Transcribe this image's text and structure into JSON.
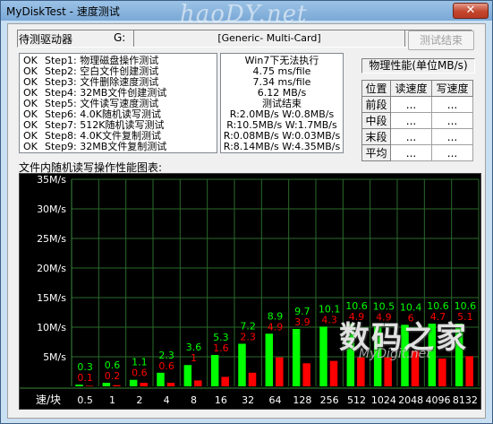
{
  "window": {
    "title": "MyDiskTest - 速度测试",
    "watermark_top": "haoDY.net",
    "close_label": "✕"
  },
  "toolbar": {
    "drive_label": "待测驱动器",
    "drive_letter": "G:",
    "drive_name": "[Generic- Multi-Card]",
    "end_button": "测试结束"
  },
  "steps": [
    {
      "status": "OK",
      "name": "Step1: 物理磁盘操作测试"
    },
    {
      "status": "OK",
      "name": "Step2: 空白文件创建测试"
    },
    {
      "status": "OK",
      "name": "Step3: 文件删除速度测试"
    },
    {
      "status": "OK",
      "name": "Step4: 32MB文件创建测试"
    },
    {
      "status": "OK",
      "name": "Step5: 文件读写速度测试"
    },
    {
      "status": "OK",
      "name": "Step6: 4.0K随机读写测试"
    },
    {
      "status": "OK",
      "name": "Step7: 512K随机读写测试"
    },
    {
      "status": "OK",
      "name": "Step8: 4.0K文件复制测试"
    },
    {
      "status": "OK",
      "name": "Step9: 32MB文件复制测试"
    }
  ],
  "results": [
    "Win7下无法执行",
    "4.75 ms/file",
    "7.34 ms/file",
    "6.12 MB/s",
    "测试结束",
    "R:2.0MB/s W:0.8MB/s",
    "R:10.5MB/s W:1.7MB/s",
    "R:0.08MB/s W:0.03MB/s",
    "R:8.14MB/s W:4.35MB/s"
  ],
  "performance": {
    "title": "物理性能(单位MB/s)",
    "headers": [
      "位置",
      "读速度",
      "写速度"
    ],
    "rows": [
      {
        "pos": "前段",
        "read": "...",
        "write": "..."
      },
      {
        "pos": "中段",
        "read": "...",
        "write": "..."
      },
      {
        "pos": "末段",
        "read": "...",
        "write": "..."
      },
      {
        "pos": "平均",
        "read": "...",
        "write": "..."
      }
    ]
  },
  "chart_label": "文件内随机读写操作性能图表:",
  "chart_data": {
    "type": "bar",
    "ylim": [
      0,
      35
    ],
    "yticks": [
      5,
      10,
      15,
      20,
      25,
      30,
      35
    ],
    "ytick_labels": [
      "5M/s",
      "10M/s",
      "15M/s",
      "20M/s",
      "25M/s",
      "30M/s",
      "35M/s"
    ],
    "x_header": "速/块",
    "categories": [
      "0.5",
      "1",
      "2",
      "4",
      "8",
      "16",
      "32",
      "64",
      "128",
      "256",
      "512",
      "1024",
      "2048",
      "4096",
      "8192"
    ],
    "category_labels": [
      "0.5",
      "1",
      "2",
      "4",
      "8",
      "16",
      "32",
      "64",
      "128",
      "256",
      "512",
      "1024",
      "2048",
      "4096",
      "8132"
    ],
    "grid": true,
    "series": [
      {
        "color": "#00ff00",
        "values": [
          0.3,
          0.6,
          1.1,
          2.3,
          3.6,
          5.3,
          7.2,
          8.9,
          9.7,
          10.1,
          10.6,
          10.5,
          10.4,
          10.6,
          10.6
        ]
      },
      {
        "color": "#ff0000",
        "values": [
          0.1,
          0.2,
          0.6,
          0.6,
          1.0,
          1.6,
          2.3,
          4.9,
          3.9,
          4.3,
          4.9,
          4.9,
          6.0,
          4.7,
          5.1
        ]
      }
    ]
  },
  "watermark": {
    "cn": "数码之家",
    "site": "MyDigit.net"
  }
}
